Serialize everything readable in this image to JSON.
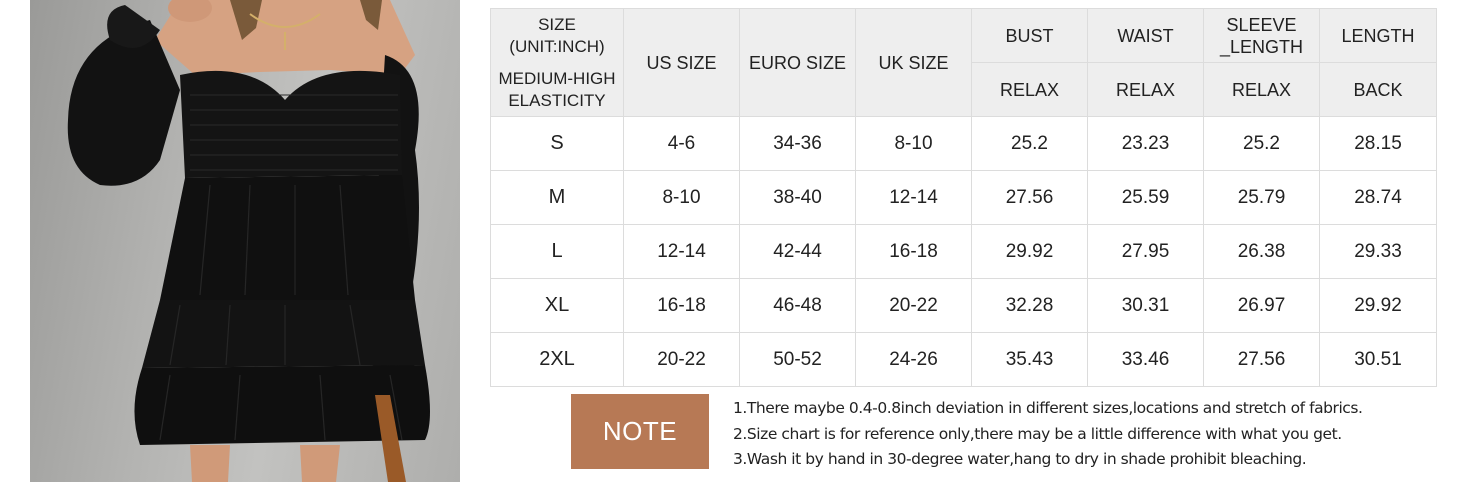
{
  "size_chart": {
    "header": {
      "corner_top": "SIZE\n(UNIT:INCH)",
      "corner_top_line1": "SIZE",
      "corner_top_line2": "(UNIT:INCH)",
      "corner_bottom_line1": "MEDIUM-HIGH",
      "corner_bottom_line2": "ELASTICITY",
      "us_size": "US SIZE",
      "euro_size": "EURO SIZE",
      "uk_size": "UK SIZE",
      "bust": "BUST",
      "waist": "WAIST",
      "sleeve_line1": "SLEEVE",
      "sleeve_line2": "_LENGTH",
      "length": "LENGTH",
      "bust_sub": "RELAX",
      "waist_sub": "RELAX",
      "sleeve_sub": "RELAX",
      "length_sub": "BACK"
    },
    "rows": [
      [
        "S",
        "4-6",
        "34-36",
        "8-10",
        "25.2",
        "23.23",
        "25.2",
        "28.15"
      ],
      [
        "M",
        "8-10",
        "38-40",
        "12-14",
        "27.56",
        "25.59",
        "25.79",
        "28.74"
      ],
      [
        "L",
        "12-14",
        "42-44",
        "16-18",
        "29.92",
        "27.95",
        "26.38",
        "29.33"
      ],
      [
        "XL",
        "16-18",
        "46-48",
        "20-22",
        "32.28",
        "30.31",
        "26.97",
        "29.92"
      ],
      [
        "2XL",
        "20-22",
        "50-52",
        "24-26",
        "35.43",
        "33.46",
        "27.56",
        "30.51"
      ]
    ]
  },
  "note": {
    "badge": "NOTE",
    "lines": [
      "1.There maybe 0.4-0.8inch deviation in different sizes,locations and stretch of fabrics.",
      "2.Size chart is for reference only,there may be a little difference with what you get.",
      "3.Wash it by hand in 30-degree water,hang to dry in shade prohibit bleaching."
    ]
  },
  "colors": {
    "note_badge": "#b77955",
    "header_bg": "#eeeeee",
    "border": "#dcdcdc"
  }
}
